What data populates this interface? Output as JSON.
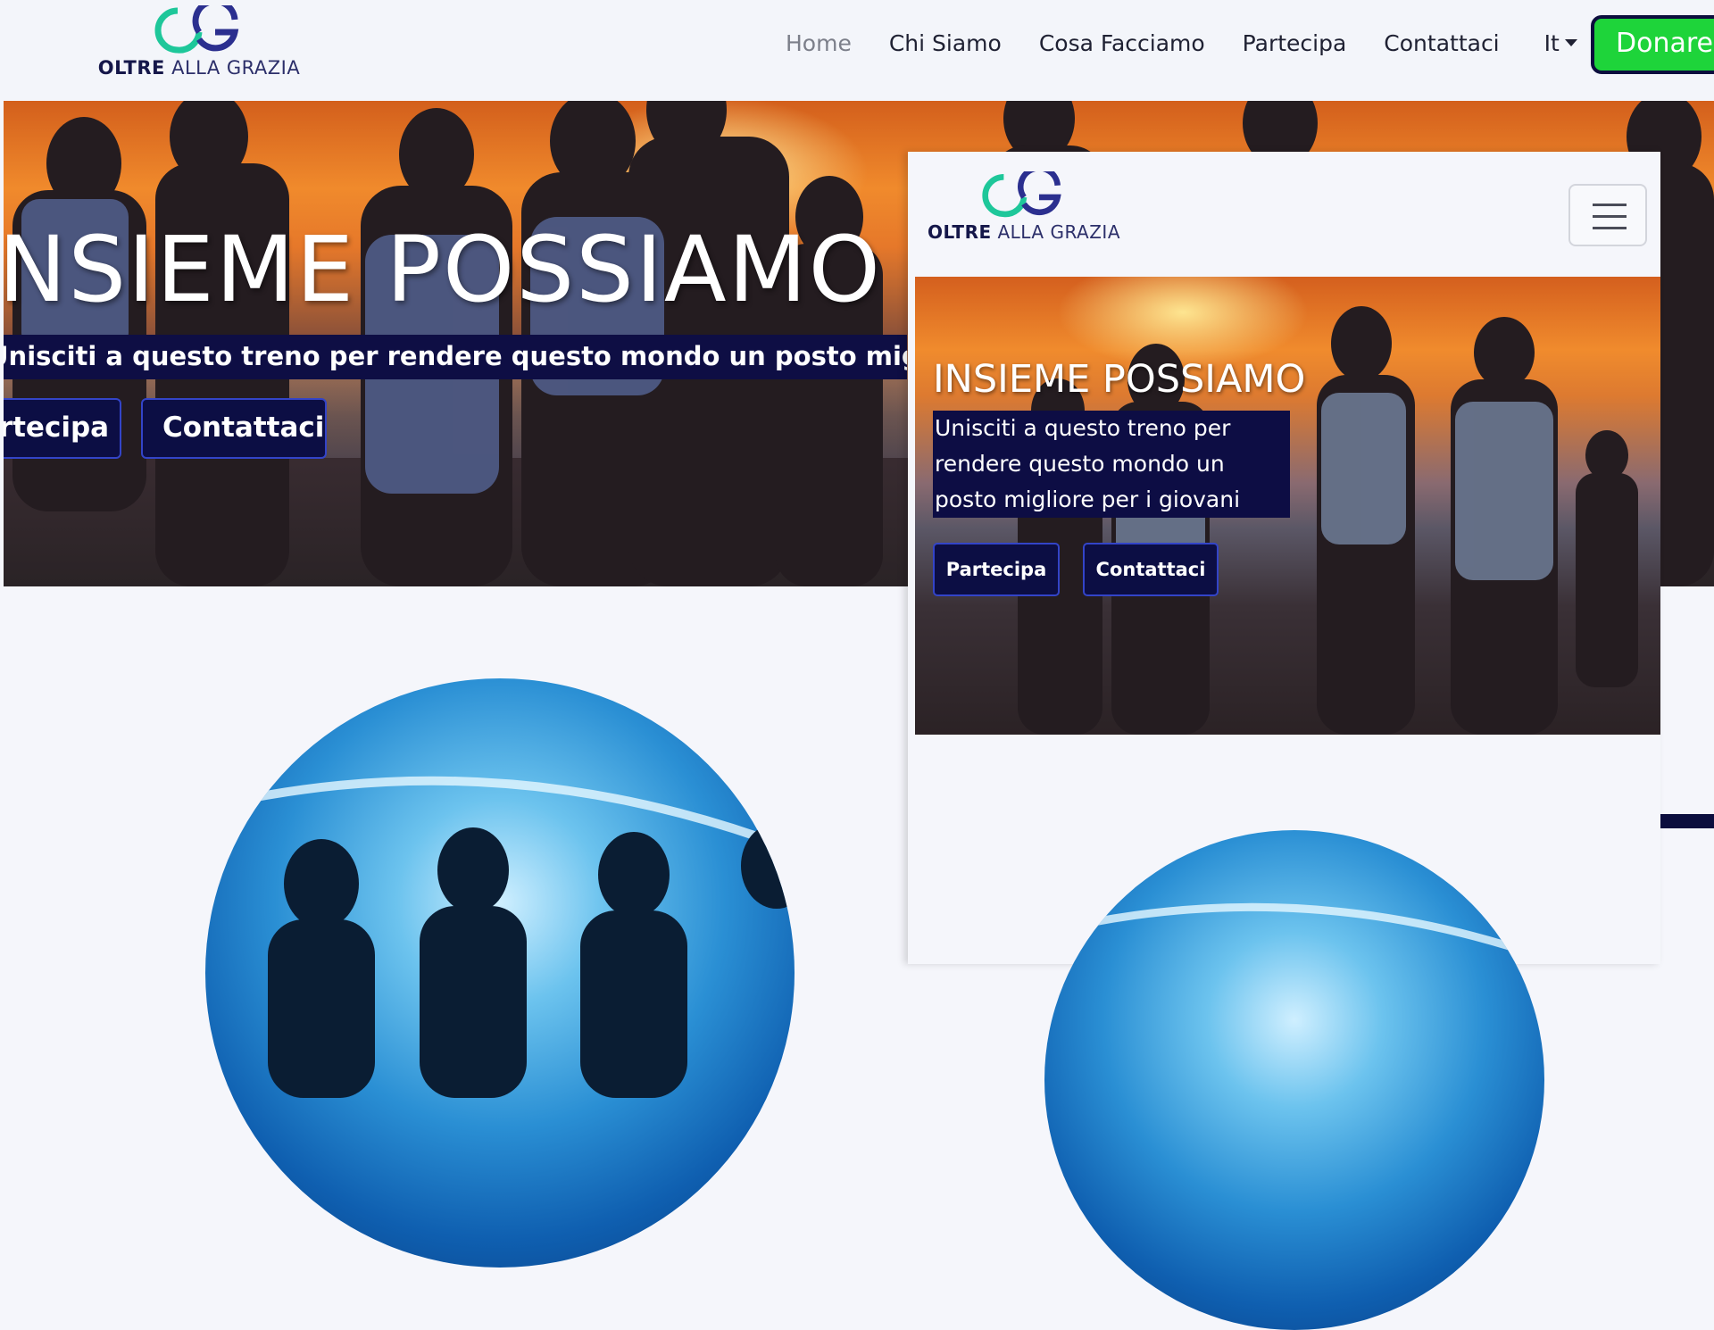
{
  "brand": {
    "word_bold": "OLTRE",
    "word_light": "ALLA GRAZIA",
    "colors": {
      "teal": "#1ec79a",
      "indigo": "#2e2f8e",
      "navy": "#0c0e44",
      "green": "#1ed43a"
    }
  },
  "nav": {
    "items": [
      "Home",
      "Chi Siamo",
      "Cosa Facciamo",
      "Partecipa",
      "Contattaci"
    ],
    "active": "Home",
    "language": "It",
    "donate_label": "Donare"
  },
  "hero": {
    "title": "INSIEME POSSIAMO",
    "subtitle": "Unisciti a questo treno per rendere questo mondo un posto migliore per i giovani",
    "buttons": {
      "partecipa": "Partecipa",
      "contattaci": "Contattaci"
    }
  },
  "mobile": {
    "menu_icon": "hamburger-icon",
    "hero": {
      "title": "INSIEME POSSIAMO",
      "subtitle": "Unisciti a questo treno per rendere questo mondo un posto migliore per i giovani",
      "buttons": {
        "partecipa": "Partecipa",
        "contattaci": "Contattaci"
      }
    }
  }
}
